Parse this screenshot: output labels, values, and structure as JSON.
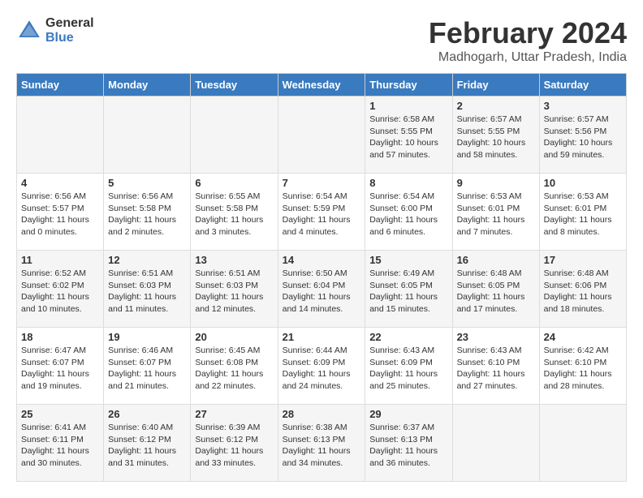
{
  "header": {
    "logo_general": "General",
    "logo_blue": "Blue",
    "month_title": "February 2024",
    "location": "Madhogarh, Uttar Pradesh, India"
  },
  "weekdays": [
    "Sunday",
    "Monday",
    "Tuesday",
    "Wednesday",
    "Thursday",
    "Friday",
    "Saturday"
  ],
  "weeks": [
    [
      {
        "day": "",
        "info": ""
      },
      {
        "day": "",
        "info": ""
      },
      {
        "day": "",
        "info": ""
      },
      {
        "day": "",
        "info": ""
      },
      {
        "day": "1",
        "info": "Sunrise: 6:58 AM\nSunset: 5:55 PM\nDaylight: 10 hours\nand 57 minutes."
      },
      {
        "day": "2",
        "info": "Sunrise: 6:57 AM\nSunset: 5:55 PM\nDaylight: 10 hours\nand 58 minutes."
      },
      {
        "day": "3",
        "info": "Sunrise: 6:57 AM\nSunset: 5:56 PM\nDaylight: 10 hours\nand 59 minutes."
      }
    ],
    [
      {
        "day": "4",
        "info": "Sunrise: 6:56 AM\nSunset: 5:57 PM\nDaylight: 11 hours\nand 0 minutes."
      },
      {
        "day": "5",
        "info": "Sunrise: 6:56 AM\nSunset: 5:58 PM\nDaylight: 11 hours\nand 2 minutes."
      },
      {
        "day": "6",
        "info": "Sunrise: 6:55 AM\nSunset: 5:58 PM\nDaylight: 11 hours\nand 3 minutes."
      },
      {
        "day": "7",
        "info": "Sunrise: 6:54 AM\nSunset: 5:59 PM\nDaylight: 11 hours\nand 4 minutes."
      },
      {
        "day": "8",
        "info": "Sunrise: 6:54 AM\nSunset: 6:00 PM\nDaylight: 11 hours\nand 6 minutes."
      },
      {
        "day": "9",
        "info": "Sunrise: 6:53 AM\nSunset: 6:01 PM\nDaylight: 11 hours\nand 7 minutes."
      },
      {
        "day": "10",
        "info": "Sunrise: 6:53 AM\nSunset: 6:01 PM\nDaylight: 11 hours\nand 8 minutes."
      }
    ],
    [
      {
        "day": "11",
        "info": "Sunrise: 6:52 AM\nSunset: 6:02 PM\nDaylight: 11 hours\nand 10 minutes."
      },
      {
        "day": "12",
        "info": "Sunrise: 6:51 AM\nSunset: 6:03 PM\nDaylight: 11 hours\nand 11 minutes."
      },
      {
        "day": "13",
        "info": "Sunrise: 6:51 AM\nSunset: 6:03 PM\nDaylight: 11 hours\nand 12 minutes."
      },
      {
        "day": "14",
        "info": "Sunrise: 6:50 AM\nSunset: 6:04 PM\nDaylight: 11 hours\nand 14 minutes."
      },
      {
        "day": "15",
        "info": "Sunrise: 6:49 AM\nSunset: 6:05 PM\nDaylight: 11 hours\nand 15 minutes."
      },
      {
        "day": "16",
        "info": "Sunrise: 6:48 AM\nSunset: 6:05 PM\nDaylight: 11 hours\nand 17 minutes."
      },
      {
        "day": "17",
        "info": "Sunrise: 6:48 AM\nSunset: 6:06 PM\nDaylight: 11 hours\nand 18 minutes."
      }
    ],
    [
      {
        "day": "18",
        "info": "Sunrise: 6:47 AM\nSunset: 6:07 PM\nDaylight: 11 hours\nand 19 minutes."
      },
      {
        "day": "19",
        "info": "Sunrise: 6:46 AM\nSunset: 6:07 PM\nDaylight: 11 hours\nand 21 minutes."
      },
      {
        "day": "20",
        "info": "Sunrise: 6:45 AM\nSunset: 6:08 PM\nDaylight: 11 hours\nand 22 minutes."
      },
      {
        "day": "21",
        "info": "Sunrise: 6:44 AM\nSunset: 6:09 PM\nDaylight: 11 hours\nand 24 minutes."
      },
      {
        "day": "22",
        "info": "Sunrise: 6:43 AM\nSunset: 6:09 PM\nDaylight: 11 hours\nand 25 minutes."
      },
      {
        "day": "23",
        "info": "Sunrise: 6:43 AM\nSunset: 6:10 PM\nDaylight: 11 hours\nand 27 minutes."
      },
      {
        "day": "24",
        "info": "Sunrise: 6:42 AM\nSunset: 6:10 PM\nDaylight: 11 hours\nand 28 minutes."
      }
    ],
    [
      {
        "day": "25",
        "info": "Sunrise: 6:41 AM\nSunset: 6:11 PM\nDaylight: 11 hours\nand 30 minutes."
      },
      {
        "day": "26",
        "info": "Sunrise: 6:40 AM\nSunset: 6:12 PM\nDaylight: 11 hours\nand 31 minutes."
      },
      {
        "day": "27",
        "info": "Sunrise: 6:39 AM\nSunset: 6:12 PM\nDaylight: 11 hours\nand 33 minutes."
      },
      {
        "day": "28",
        "info": "Sunrise: 6:38 AM\nSunset: 6:13 PM\nDaylight: 11 hours\nand 34 minutes."
      },
      {
        "day": "29",
        "info": "Sunrise: 6:37 AM\nSunset: 6:13 PM\nDaylight: 11 hours\nand 36 minutes."
      },
      {
        "day": "",
        "info": ""
      },
      {
        "day": "",
        "info": ""
      }
    ]
  ]
}
